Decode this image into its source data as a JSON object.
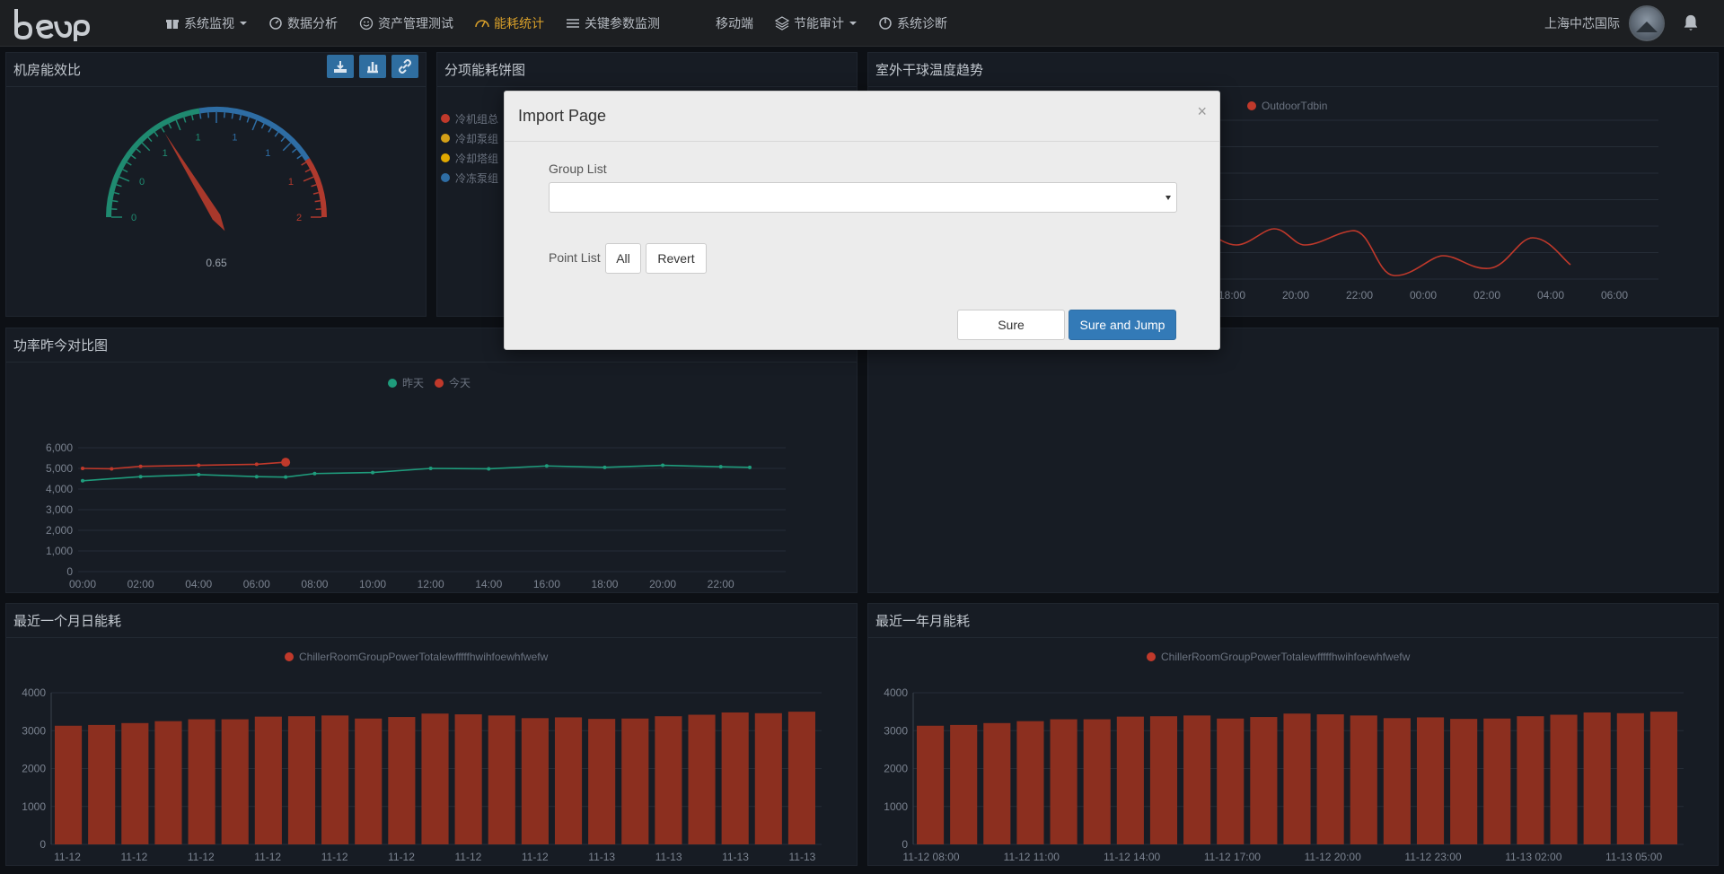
{
  "nav": {
    "items": [
      {
        "label": "系统监视",
        "icon": "gift-icon",
        "caret": true
      },
      {
        "label": "数据分析",
        "icon": "gauge-icon",
        "caret": false
      },
      {
        "label": "资产管理测试",
        "icon": "smile-icon",
        "caret": false
      },
      {
        "label": "能耗统计",
        "icon": "dashboard-icon",
        "caret": false,
        "active": true
      },
      {
        "label": "关键参数监测",
        "icon": "list-icon",
        "caret": false
      },
      {
        "label": "移动端",
        "icon": "",
        "caret": false
      },
      {
        "label": "节能审计",
        "icon": "layers-icon",
        "caret": true
      },
      {
        "label": "系统诊断",
        "icon": "power-icon",
        "caret": false
      }
    ],
    "site_name": "上海中芯国际"
  },
  "panels": {
    "efficiency": {
      "title": "机房能效比",
      "value": "0.65",
      "ticks": [
        "0",
        "0",
        "1",
        "1",
        "1",
        "1",
        "1",
        "2"
      ]
    },
    "pie": {
      "title": "分项能耗饼图",
      "legend": [
        "冷机组总",
        "冷却泵组",
        "冷却塔组",
        "冷冻泵组"
      ],
      "colors": [
        "#c0392b",
        "#d4a017",
        "#e0a800",
        "#2e6da4"
      ]
    },
    "outdoor": {
      "title": "室外干球温度趋势",
      "legend": "OutdoorTdbin"
    },
    "power": {
      "title": "功率昨今对比图",
      "legend_yesterday": "昨天",
      "legend_today": "今天"
    },
    "month": {
      "title": "最近一个月日能耗",
      "legend": "ChillerRoomGroupPowerTotalewfffffhwihfoewhfwefw"
    },
    "year": {
      "title": "最近一年月能耗",
      "legend": "ChillerRoomGroupPowerTotalewfffffhwihfoewhfwefw"
    }
  },
  "chart_data": [
    {
      "type": "line",
      "title": "室外干球温度趋势",
      "categories": [
        "18:00",
        "20:00",
        "22:00",
        "00:00",
        "02:00",
        "04:00",
        "06:00"
      ],
      "series": [
        {
          "name": "OutdoorTdbin",
          "color": "#c0392b"
        }
      ]
    },
    {
      "type": "line",
      "title": "功率昨今对比图",
      "categories": [
        "00:00",
        "02:00",
        "04:00",
        "06:00",
        "08:00",
        "10:00",
        "12:00",
        "14:00",
        "16:00",
        "18:00",
        "20:00",
        "22:00"
      ],
      "yticks": [
        "0",
        "1,000",
        "2,000",
        "3,000",
        "4,000",
        "5,000",
        "6,000"
      ],
      "ylim": [
        0,
        6000
      ],
      "series": [
        {
          "name": "昨天",
          "color": "#1f9c7c",
          "x": [
            0,
            2,
            4,
            6,
            7,
            8,
            10,
            12,
            14,
            16,
            18,
            20,
            22,
            23
          ],
          "values": [
            4400,
            4600,
            4700,
            4600,
            4580,
            4750,
            4800,
            5000,
            4980,
            5120,
            5050,
            5150,
            5080,
            5050
          ]
        },
        {
          "name": "今天",
          "color": "#c0392b",
          "x": [
            0,
            1,
            2,
            4,
            6,
            7
          ],
          "values": [
            5000,
            4980,
            5100,
            5150,
            5200,
            5300
          ]
        }
      ]
    },
    {
      "type": "bar",
      "title": "最近一个月日能耗",
      "series_name": "ChillerRoomGroupPowerTotalewfffffhwihfoewhfwefw",
      "xticks": [
        "11-12",
        "11-12",
        "11-12",
        "11-12",
        "11-12",
        "11-12",
        "11-12",
        "11-12",
        "11-13",
        "11-13",
        "11-13",
        "11-13"
      ],
      "yticks": [
        "0",
        "1000",
        "2000",
        "3000",
        "4000"
      ],
      "ylim": [
        0,
        4000
      ],
      "values": [
        3130,
        3150,
        3200,
        3250,
        3300,
        3300,
        3370,
        3380,
        3400,
        3320,
        3360,
        3450,
        3430,
        3400,
        3330,
        3350,
        3310,
        3320,
        3380,
        3420,
        3480,
        3460,
        3500
      ],
      "color": "#8c2f1f"
    },
    {
      "type": "bar",
      "title": "最近一年月能耗",
      "series_name": "ChillerRoomGroupPowerTotalewfffffhwihfoewhfwefw",
      "xticks": [
        "11-12 08:00",
        "11-12 11:00",
        "11-12 14:00",
        "11-12 17:00",
        "11-12 20:00",
        "11-12 23:00",
        "11-13 02:00",
        "11-13 05:00"
      ],
      "yticks": [
        "0",
        "1000",
        "2000",
        "3000",
        "4000"
      ],
      "ylim": [
        0,
        4000
      ],
      "values": [
        3130,
        3150,
        3200,
        3250,
        3300,
        3300,
        3370,
        3380,
        3400,
        3320,
        3360,
        3450,
        3430,
        3400,
        3330,
        3350,
        3310,
        3320,
        3380,
        3420,
        3480,
        3460,
        3500
      ],
      "color": "#8c2f1f"
    }
  ],
  "modal": {
    "title": "Import Page",
    "close": "×",
    "group_label": "Group List",
    "group_value": "",
    "point_label": "Point List",
    "all_label": "All",
    "revert_label": "Revert",
    "sure_label": "Sure",
    "jump_label": "Sure and Jump"
  }
}
